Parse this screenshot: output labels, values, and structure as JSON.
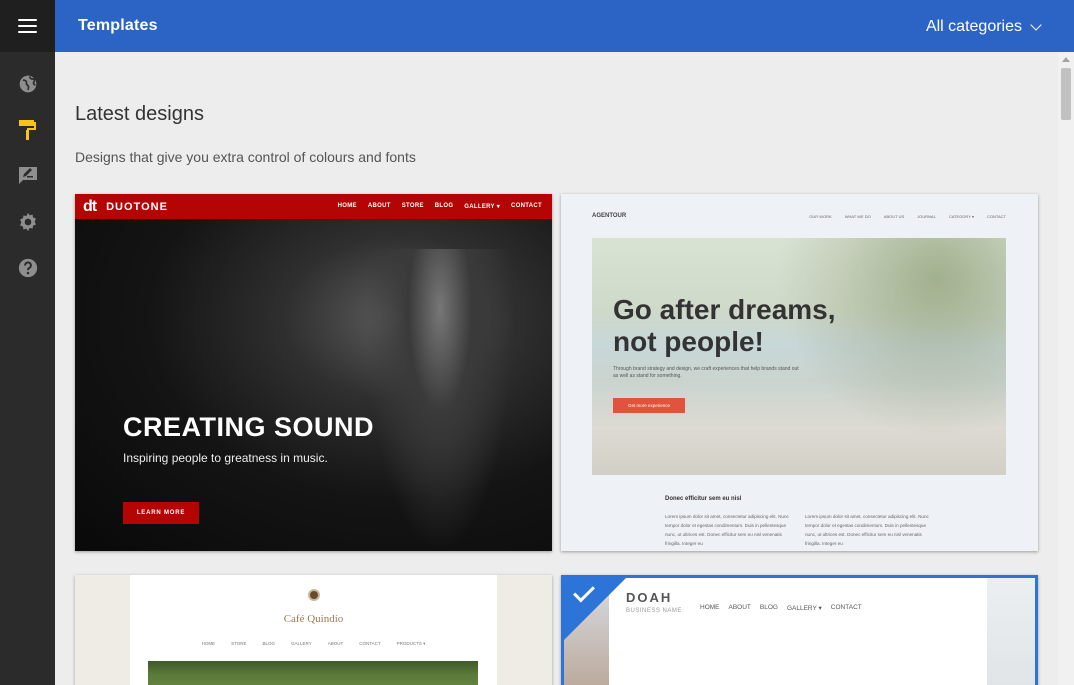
{
  "app": {
    "menu_icon": "hamburger-menu-icon",
    "title": "Templates",
    "category_filter": "All categories",
    "accent_color": "#2c64c6",
    "selection_color": "#2c74d8"
  },
  "sidebar": {
    "items": [
      {
        "icon": "globe-icon",
        "active": false
      },
      {
        "icon": "paint-roller-icon",
        "active": true,
        "color": "#f5c518"
      },
      {
        "icon": "edit-note-icon",
        "active": false
      },
      {
        "icon": "gear-icon",
        "active": false
      },
      {
        "icon": "help-icon",
        "active": false
      }
    ]
  },
  "main": {
    "heading": "Latest designs",
    "subheading": "Designs that give you extra control of colours and fonts"
  },
  "templates": [
    {
      "logo": "dt",
      "brand": "DUOTONE",
      "menu": [
        "HOME",
        "ABOUT",
        "STORE",
        "BLOG",
        "GALLERY ▾",
        "CONTACT"
      ],
      "hero_title": "CREATING SOUND",
      "hero_sub": "Inspiring people to greatness in music.",
      "button": "LEARN MORE",
      "selected": false
    },
    {
      "brand": "AGENTOUR",
      "menu": [
        "OUR WORK",
        "WHAT WE DO",
        "ABOUT US",
        "JOURNAL",
        "CATEGORY ▾",
        "CONTACT"
      ],
      "hero_line1": "Go after dreams,",
      "hero_line2": "not people!",
      "lead": "Through brand strategy and design, we craft experiences that help brands stand out as well as stand for something.",
      "button": "Get more experience",
      "text_title": "Donec efficitur sem eu nisl",
      "col1": "Lorem ipsum dolor sit amet, consectetur adipiscing elit. Nunc tempor dolor et egestas condimentum. Duis in pellentesque nunc, ut ultrices est. Donec efficitur sem eu nisl venenatis fringilla. Integer eu",
      "col2": "Lorem ipsum dolor sit amet, consectetur adipiscing elit. Nunc tempor dolor et egestas condimentum. Duis in pellentesque nunc, ut ultrices est. Donec efficitur sem eu nisl venenatis fringilla. Integer eu",
      "selected": false
    },
    {
      "brand": "Café Quindío",
      "menu": [
        "HOME",
        "STORE",
        "BLOG",
        "GALLERY",
        "ABOUT",
        "CONTACT",
        "PRODUCTS ▾"
      ],
      "selected": false
    },
    {
      "brand": "DOAH",
      "tagline": "BUSINESS NAME",
      "menu": [
        "HOME",
        "ABOUT",
        "BLOG",
        "GALLERY ▾",
        "CONTACT"
      ],
      "selected": true
    }
  ]
}
